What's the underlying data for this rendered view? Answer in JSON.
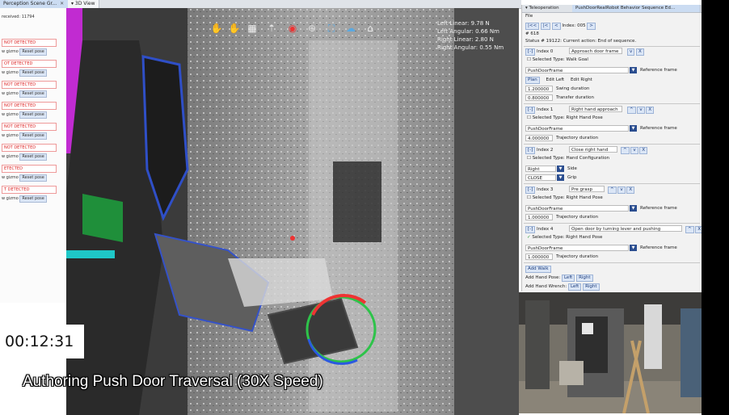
{
  "tabs": {
    "perception": "Perception Scene Gr...",
    "view3d": "3D View"
  },
  "left_panel": {
    "status": "received: 11794",
    "rows": [
      {
        "status": "NOT DETECTED",
        "gizmo": "w gizmo",
        "reset": "Reset pose"
      },
      {
        "status": "OT DETECTED",
        "gizmo": "w gizmo",
        "reset": "Reset pose"
      },
      {
        "status": "NOT DETECTED",
        "gizmo": "w gizmo",
        "reset": "Reset pose"
      },
      {
        "status": "NOT DETECTED",
        "gizmo": "w gizmo",
        "reset": "Reset pose"
      },
      {
        "status": "NOT DETECTED",
        "gizmo": "w gizmo",
        "reset": "Reset pose"
      },
      {
        "status": "NOT DETECTED",
        "gizmo": "w gizmo",
        "reset": "Reset pose"
      },
      {
        "status": "ETECTED",
        "gizmo": "w gizmo",
        "reset": "Reset pose"
      },
      {
        "status": "T DETECTED",
        "gizmo": "w gizmo",
        "reset": "Reset pose"
      }
    ]
  },
  "view3d": {
    "readout": {
      "left_linear": "Left Linear: 9.78 N",
      "left_angular": "Left Angular: 0.66 Nm",
      "right_linear": "Right Linear: 2.80 N",
      "right_angular": "Right Angular: 0.55 Nm"
    },
    "toolbar_icons": [
      "left-hand-icon",
      "right-hand-icon",
      "sequence-icon",
      "walk-icon",
      "toggle-icon",
      "target-icon",
      "pointcloud-icon",
      "wrench-icon",
      "home-icon"
    ]
  },
  "timer": "00:12:31",
  "caption": "Authoring Push Door Traversal (30X Speed)",
  "teleop": {
    "tab1": "Teleoperation",
    "tab2": "PushDoorRealRobot Behavior Sequence Ed...",
    "menu_file": "File",
    "nav": {
      "first": "|<<",
      "prev_all": "|<",
      "prev": "<",
      "index_label": "Index: 005",
      "next": ">"
    },
    "hash": "# 618",
    "status": "Status # 19122: Current action:  End of sequence.",
    "actions": [
      {
        "index": "Index 0",
        "name": "Approach door frame",
        "selected": "Selected",
        "type": "Type: Walk Goal",
        "frame": "PushDoorFrame",
        "ref": "Reference frame",
        "tabs": [
          "Plan",
          "Edit Left",
          "Edit Right"
        ],
        "params": [
          {
            "value": "1.200000",
            "label": "Swing duration"
          },
          {
            "value": "0.800000",
            "label": "Transfer duration"
          }
        ]
      },
      {
        "index": "Index 1",
        "name": "Right hand approach",
        "selected": "Selected",
        "type": "Type: Right Hand Pose",
        "frame": "PushDoorFrame",
        "ref": "Reference frame",
        "params": [
          {
            "value": "4.000000",
            "label": "Trajectory duration"
          }
        ]
      },
      {
        "index": "Index 2",
        "name": "Close right hand",
        "selected": "Selected",
        "type": "Type: Hand Configuration",
        "side_value": "Right",
        "side_label": "Side",
        "grip_value": "CLOSE",
        "grip_label": "Grip"
      },
      {
        "index": "Index 3",
        "name": "Pre grasp",
        "selected": "Selected",
        "type": "Type: Right Hand Pose",
        "frame": "PushDoorFrame",
        "ref": "Reference frame",
        "params": [
          {
            "value": "1.000000",
            "label": "Trajectory duration"
          }
        ]
      },
      {
        "index": "Index 4",
        "name": "Open door by turning lever and pushing",
        "selected": "Selected",
        "type": "Type: Right Hand Pose",
        "frame": "PushDoorFrame",
        "ref": "Reference frame",
        "params": [
          {
            "value": "1.000000",
            "label": "Trajectory duration"
          }
        ]
      }
    ],
    "add_walk": "Add Walk",
    "add_hand_pose": "Add Hand Pose:",
    "add_hand_wrench": "Add Hand Wrench:",
    "left": "Left",
    "right": "Right",
    "x": "X",
    "up": "^",
    "down": "v"
  }
}
